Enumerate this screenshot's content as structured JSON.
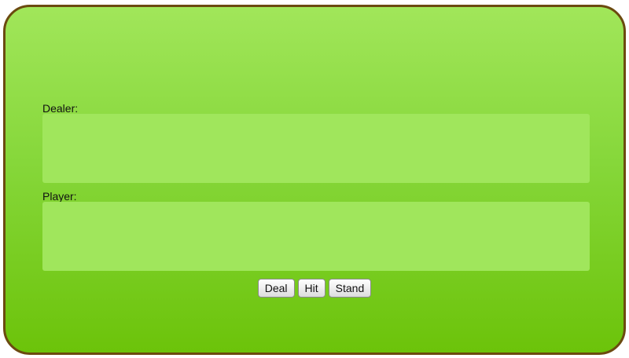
{
  "dealer": {
    "label": "Dealer:",
    "cards": []
  },
  "player": {
    "label": "Player:",
    "cards": []
  },
  "controls": {
    "deal_label": "Deal",
    "hit_label": "Hit",
    "stand_label": "Stand"
  },
  "colors": {
    "table_border": "#6b4a10",
    "felt_top": "#a1e65a",
    "felt_bottom": "#6cc30a",
    "hand_area": "#a0e65c"
  }
}
